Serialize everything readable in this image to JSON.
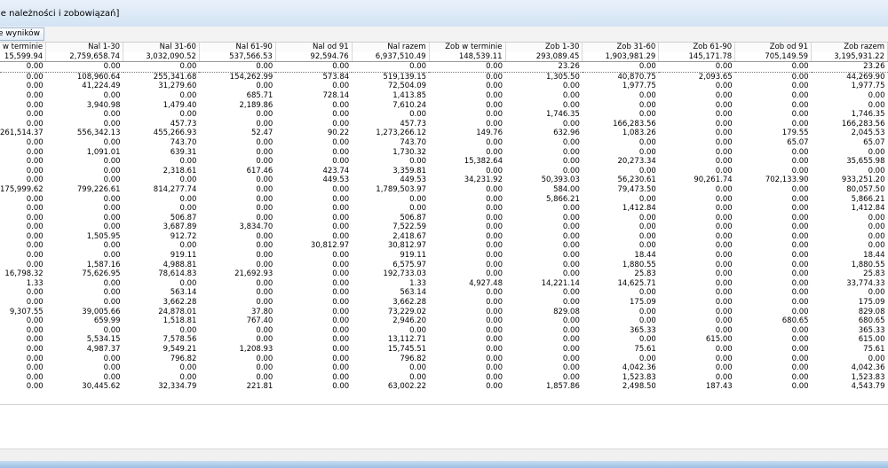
{
  "window": {
    "title": "ie należności i zobowiązań]"
  },
  "toolbar": {
    "button_label": "e wyników"
  },
  "table": {
    "columns": [
      "w terminie",
      "Nal 1-30",
      "Nal 31-60",
      "Nal 61-90",
      "Nal od 91",
      "Nal razem",
      "Zob w terminie",
      "Zob 1-30",
      "Zob 31-60",
      "Zob 61-90",
      "Zob od 91",
      "Zob razem"
    ],
    "totals": [
      "15,599.94",
      "2,759,658.74",
      "3,032,090.52",
      "537,566.53",
      "92,594.76",
      "6,937,510.49",
      "148,539.11",
      "293,089.45",
      "1,903,981.29",
      "145,171.78",
      "705,149.59",
      "3,195,931.22"
    ],
    "rows": [
      [
        "0.00",
        "0.00",
        "0.00",
        "0.00",
        "0.00",
        "0.00",
        "0.00",
        "23.26",
        "0.00",
        "0.00",
        "0.00",
        "23.26"
      ],
      [
        "0.00",
        "108,960.64",
        "255,341.68",
        "154,262.99",
        "573.84",
        "519,139.15",
        "0.00",
        "1,305.50",
        "40,870.75",
        "2,093.65",
        "0.00",
        "44,269.90"
      ],
      [
        "0.00",
        "41,224.49",
        "31,279.60",
        "0.00",
        "0.00",
        "72,504.09",
        "0.00",
        "0.00",
        "1,977.75",
        "0.00",
        "0.00",
        "1,977.75"
      ],
      [
        "0.00",
        "0.00",
        "0.00",
        "685.71",
        "728.14",
        "1,413.85",
        "0.00",
        "0.00",
        "0.00",
        "0.00",
        "0.00",
        "0.00"
      ],
      [
        "0.00",
        "3,940.98",
        "1,479.40",
        "2,189.86",
        "0.00",
        "7,610.24",
        "0.00",
        "0.00",
        "0.00",
        "0.00",
        "0.00",
        "0.00"
      ],
      [
        "0.00",
        "0.00",
        "0.00",
        "0.00",
        "0.00",
        "0.00",
        "0.00",
        "1,746.35",
        "0.00",
        "0.00",
        "0.00",
        "1,746.35"
      ],
      [
        "0.00",
        "0.00",
        "457.73",
        "0.00",
        "0.00",
        "457.73",
        "0.00",
        "0.00",
        "166,283.56",
        "0.00",
        "0.00",
        "166,283.56"
      ],
      [
        "261,514.37",
        "556,342.13",
        "455,266.93",
        "52.47",
        "90.22",
        "1,273,266.12",
        "149.76",
        "632.96",
        "1,083.26",
        "0.00",
        "179.55",
        "2,045.53"
      ],
      [
        "0.00",
        "0.00",
        "743.70",
        "0.00",
        "0.00",
        "743.70",
        "0.00",
        "0.00",
        "0.00",
        "0.00",
        "65.07",
        "65.07"
      ],
      [
        "0.00",
        "1,091.01",
        "639.31",
        "0.00",
        "0.00",
        "1,730.32",
        "0.00",
        "0.00",
        "0.00",
        "0.00",
        "0.00",
        "0.00"
      ],
      [
        "0.00",
        "0.00",
        "0.00",
        "0.00",
        "0.00",
        "0.00",
        "15,382.64",
        "0.00",
        "20,273.34",
        "0.00",
        "0.00",
        "35,655.98"
      ],
      [
        "0.00",
        "0.00",
        "2,318.61",
        "617.46",
        "423.74",
        "3,359.81",
        "0.00",
        "0.00",
        "0.00",
        "0.00",
        "0.00",
        "0.00"
      ],
      [
        "0.00",
        "0.00",
        "0.00",
        "0.00",
        "449.53",
        "449.53",
        "34,231.92",
        "50,393.03",
        "56,230.61",
        "90,261.74",
        "702,133.90",
        "933,251.20"
      ],
      [
        "175,999.62",
        "799,226.61",
        "814,277.74",
        "0.00",
        "0.00",
        "1,789,503.97",
        "0.00",
        "584.00",
        "79,473.50",
        "0.00",
        "0.00",
        "80,057.50"
      ],
      [
        "0.00",
        "0.00",
        "0.00",
        "0.00",
        "0.00",
        "0.00",
        "0.00",
        "5,866.21",
        "0.00",
        "0.00",
        "0.00",
        "5,866.21"
      ],
      [
        "0.00",
        "0.00",
        "0.00",
        "0.00",
        "0.00",
        "0.00",
        "0.00",
        "0.00",
        "1,412.84",
        "0.00",
        "0.00",
        "1,412.84"
      ],
      [
        "0.00",
        "0.00",
        "506.87",
        "0.00",
        "0.00",
        "506.87",
        "0.00",
        "0.00",
        "0.00",
        "0.00",
        "0.00",
        "0.00"
      ],
      [
        "0.00",
        "0.00",
        "3,687.89",
        "3,834.70",
        "0.00",
        "7,522.59",
        "0.00",
        "0.00",
        "0.00",
        "0.00",
        "0.00",
        "0.00"
      ],
      [
        "0.00",
        "1,505.95",
        "912.72",
        "0.00",
        "0.00",
        "2,418.67",
        "0.00",
        "0.00",
        "0.00",
        "0.00",
        "0.00",
        "0.00"
      ],
      [
        "0.00",
        "0.00",
        "0.00",
        "0.00",
        "30,812.97",
        "30,812.97",
        "0.00",
        "0.00",
        "0.00",
        "0.00",
        "0.00",
        "0.00"
      ],
      [
        "0.00",
        "0.00",
        "919.11",
        "0.00",
        "0.00",
        "919.11",
        "0.00",
        "0.00",
        "18.44",
        "0.00",
        "0.00",
        "18.44"
      ],
      [
        "0.00",
        "1,587.16",
        "4,988.81",
        "0.00",
        "0.00",
        "6,575.97",
        "0.00",
        "0.00",
        "1,880.55",
        "0.00",
        "0.00",
        "1,880.55"
      ],
      [
        "16,798.32",
        "75,626.95",
        "78,614.83",
        "21,692.93",
        "0.00",
        "192,733.03",
        "0.00",
        "0.00",
        "25.83",
        "0.00",
        "0.00",
        "25.83"
      ],
      [
        "1.33",
        "0.00",
        "0.00",
        "0.00",
        "0.00",
        "1.33",
        "4,927.48",
        "14,221.14",
        "14,625.71",
        "0.00",
        "0.00",
        "33,774.33"
      ],
      [
        "0.00",
        "0.00",
        "563.14",
        "0.00",
        "0.00",
        "563.14",
        "0.00",
        "0.00",
        "0.00",
        "0.00",
        "0.00",
        "0.00"
      ],
      [
        "0.00",
        "0.00",
        "3,662.28",
        "0.00",
        "0.00",
        "3,662.28",
        "0.00",
        "0.00",
        "175.09",
        "0.00",
        "0.00",
        "175.09"
      ],
      [
        "9,307.55",
        "39,005.66",
        "24,878.01",
        "37.80",
        "0.00",
        "73,229.02",
        "0.00",
        "829.08",
        "0.00",
        "0.00",
        "0.00",
        "829.08"
      ],
      [
        "0.00",
        "659.99",
        "1,518.81",
        "767.40",
        "0.00",
        "2,946.20",
        "0.00",
        "0.00",
        "0.00",
        "0.00",
        "680.65",
        "680.65"
      ],
      [
        "0.00",
        "0.00",
        "0.00",
        "0.00",
        "0.00",
        "0.00",
        "0.00",
        "0.00",
        "365.33",
        "0.00",
        "0.00",
        "365.33"
      ],
      [
        "0.00",
        "5,534.15",
        "7,578.56",
        "0.00",
        "0.00",
        "13,112.71",
        "0.00",
        "0.00",
        "0.00",
        "615.00",
        "0.00",
        "615.00"
      ],
      [
        "0.00",
        "4,987.37",
        "9,549.21",
        "1,208.93",
        "0.00",
        "15,745.51",
        "0.00",
        "0.00",
        "75.61",
        "0.00",
        "0.00",
        "75.61"
      ],
      [
        "0.00",
        "0.00",
        "796.82",
        "0.00",
        "0.00",
        "796.82",
        "0.00",
        "0.00",
        "0.00",
        "0.00",
        "0.00",
        "0.00"
      ],
      [
        "0.00",
        "0.00",
        "0.00",
        "0.00",
        "0.00",
        "0.00",
        "0.00",
        "0.00",
        "4,042.36",
        "0.00",
        "0.00",
        "4,042.36"
      ],
      [
        "0.00",
        "0.00",
        "0.00",
        "0.00",
        "0.00",
        "0.00",
        "0.00",
        "0.00",
        "1,523.83",
        "0.00",
        "0.00",
        "1,523.83"
      ],
      [
        "0.00",
        "30,445.62",
        "32,334.79",
        "221.81",
        "0.00",
        "63,002.22",
        "0.00",
        "1,857.86",
        "2,498.50",
        "187.43",
        "0.00",
        "4,543.79"
      ]
    ]
  }
}
